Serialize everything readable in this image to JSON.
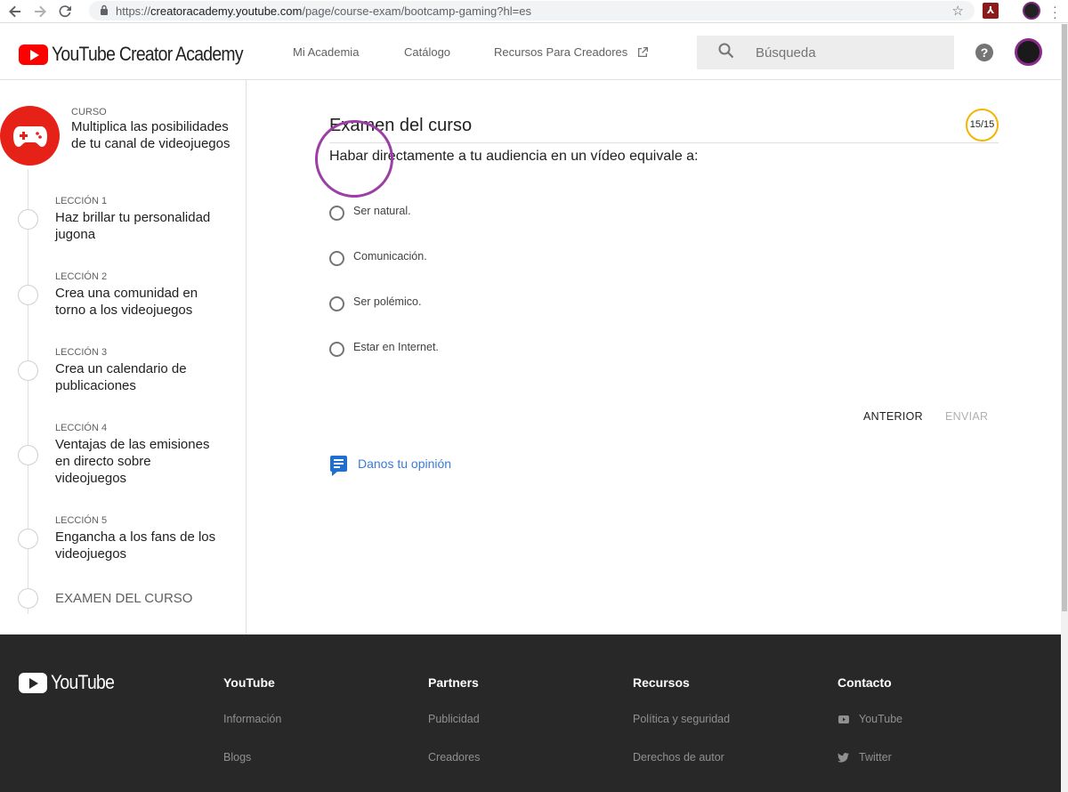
{
  "browser": {
    "url_scheme": "https://",
    "url_host": "creatoracademy.youtube.com",
    "url_path": "/page/course-exam/bootcamp-gaming?hl=es"
  },
  "header": {
    "logo_text": "YouTube Creator Academy",
    "nav": [
      "Mi Academia",
      "Catálogo",
      "Recursos Para Creadores"
    ],
    "search_label": "Búsqueda",
    "help_glyph": "?"
  },
  "sidebar": {
    "course_kicker": "CURSO",
    "course_title": "Multiplica las posibilidades de tu canal de videojuegos",
    "lessons": [
      {
        "kicker": "LECCIÓN 1",
        "title": "Haz brillar tu personalidad jugona"
      },
      {
        "kicker": "LECCIÓN 2",
        "title": "Crea una comunidad en torno a los videojuegos"
      },
      {
        "kicker": "LECCIÓN 3",
        "title": "Crea un calendario de publicaciones"
      },
      {
        "kicker": "LECCIÓN 4",
        "title": "Ventajas de las emisiones en directo sobre videojuegos"
      },
      {
        "kicker": "LECCIÓN 5",
        "title": "Engancha a los fans de los videojuegos"
      }
    ],
    "exam_label": "EXAMEN DEL CURSO"
  },
  "exam": {
    "title": "Examen del curso",
    "counter": "15/15",
    "question": "Habar directamente a tu audiencia en un vídeo equivale a:",
    "options": [
      "Ser natural.",
      "Comunicación.",
      "Ser polémico.",
      "Estar en Internet."
    ],
    "prev_label": "ANTERIOR",
    "send_label": "ENVIAR",
    "feedback_label": "Danos tu opinión"
  },
  "footer": {
    "logo_text": "YouTube",
    "columns": [
      {
        "heading": "YouTube",
        "links": [
          "Información",
          "Blogs"
        ]
      },
      {
        "heading": "Partners",
        "links": [
          "Publicidad",
          "Creadores"
        ]
      },
      {
        "heading": "Recursos",
        "links": [
          "Política y seguridad",
          "Derechos de autor"
        ]
      },
      {
        "heading": "Contacto",
        "links": [
          "YouTube",
          "Twitter"
        ]
      }
    ]
  },
  "colors": {
    "brand_red": "#ff0000",
    "course_red": "#e62117",
    "counter_ring": "#f4b400",
    "annotation_purple": "#9b3fa5",
    "link_blue": "#3a7bd5",
    "footer_bg": "#282828"
  },
  "icons": [
    "back-arrow-icon",
    "forward-arrow-icon",
    "reload-icon",
    "lock-icon",
    "star-icon",
    "external-link-icon",
    "search-icon",
    "help-icon",
    "gamepad-icon",
    "feedback-icon",
    "youtube-icon",
    "twitter-icon"
  ]
}
